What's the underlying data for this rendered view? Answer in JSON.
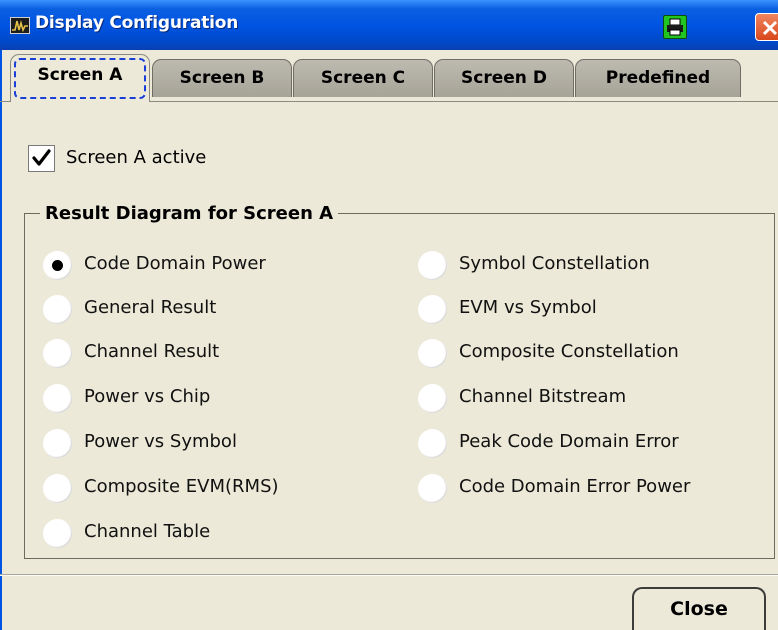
{
  "window": {
    "title": "Display Configuration",
    "icon": "app-waveform-icon"
  },
  "titlebar": {
    "print_icon": "printer-icon",
    "close_icon": "close-icon"
  },
  "tabs": [
    {
      "label": "Screen A",
      "active": true
    },
    {
      "label": "Screen B",
      "active": false
    },
    {
      "label": "Screen C",
      "active": false
    },
    {
      "label": "Screen D",
      "active": false
    },
    {
      "label": "Predefined",
      "active": false
    }
  ],
  "screen_active": {
    "label": "Screen A active",
    "checked": true
  },
  "group": {
    "legend": "Result Diagram for Screen A",
    "left_options": [
      {
        "label": "Code Domain Power",
        "selected": true
      },
      {
        "label": "General Result",
        "selected": false
      },
      {
        "label": "Channel Result",
        "selected": false
      },
      {
        "label": "Power vs Chip",
        "selected": false
      },
      {
        "label": "Power vs Symbol",
        "selected": false
      },
      {
        "label": "Composite EVM(RMS)",
        "selected": false
      },
      {
        "label": "Channel Table",
        "selected": false
      }
    ],
    "right_options": [
      {
        "label": "Symbol Constellation",
        "selected": false
      },
      {
        "label": "EVM vs Symbol",
        "selected": false
      },
      {
        "label": "Composite Constellation",
        "selected": false
      },
      {
        "label": "Channel Bitstream",
        "selected": false
      },
      {
        "label": "Peak Code Domain Error",
        "selected": false
      },
      {
        "label": "Code Domain Error Power",
        "selected": false
      }
    ]
  },
  "footer": {
    "close_label": "Close"
  },
  "colors": {
    "titlebar": "#0054e3",
    "dialog_bg": "#ece9d8",
    "focus_ring": "#1a3fd8",
    "print_button": "#22c422",
    "close_button": "#d9481c"
  }
}
